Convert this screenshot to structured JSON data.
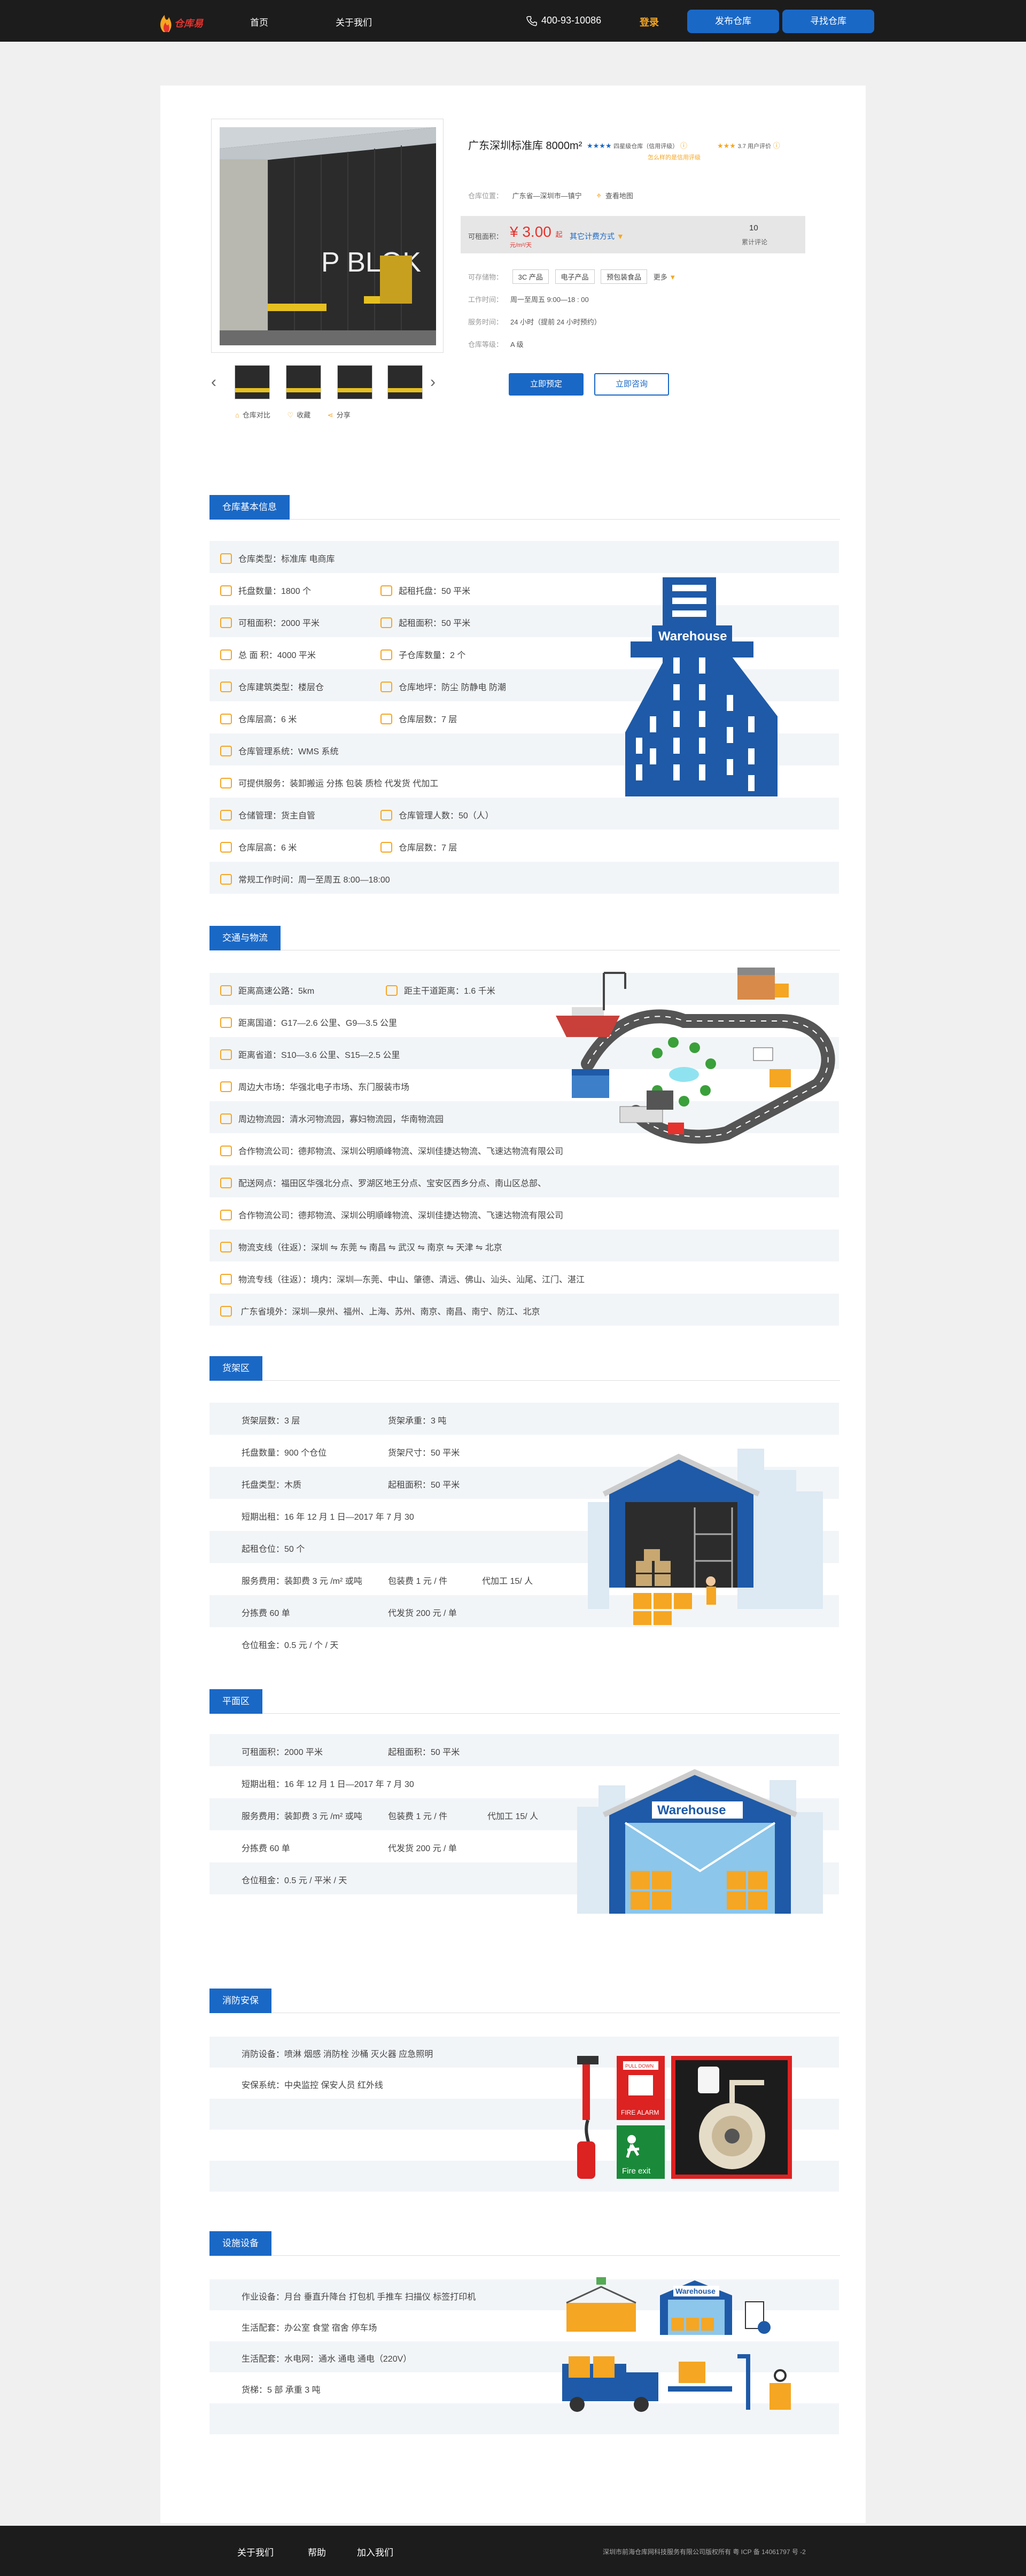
{
  "header": {
    "logo_text": "仓库易",
    "nav": [
      "首页",
      "关于我们"
    ],
    "phone": "400-93-10086",
    "login": "登录",
    "btn_publish": "发布仓库",
    "btn_find": "寻找仓库"
  },
  "product": {
    "image_sign": "P BLOK",
    "title": "广东深圳标准库 8000m²",
    "rating_blue": "★★★★",
    "rating_blue_text": "四星级仓库",
    "rating_blue_extra": "（信用评级）",
    "rating_orange": "★★★",
    "rating_orange_text": "3.7 用户评价",
    "rating_small": "怎么样的是信用评级",
    "location_label": "仓库位置：",
    "location": "广东省—深圳市—镇宁",
    "map_link": "查看地图",
    "price_label": "可租面积：",
    "price": "¥ 3.00",
    "price_unit": "起",
    "price_sub": "元/m²/天",
    "calc": "其它计费方式",
    "reviews_count": "10",
    "reviews_label": "累计评论",
    "goods_label": "可存储物：",
    "goods_tags": [
      "3C 产品",
      "电子产品",
      "预包装食品"
    ],
    "goods_more": "更多",
    "work_label": "工作时间：",
    "work": "周一至周五    9:00—18 : 00",
    "service_label": "服务时间：",
    "service": "24 小时（提前 24 小时预约）",
    "grade_label": "仓库等级：",
    "grade": "A 级",
    "btn_book": "立即预定",
    "btn_consult": "立即咨询",
    "actions": [
      "仓库对比",
      "收藏",
      "分享"
    ]
  },
  "sections": {
    "basic": {
      "title": "仓库基本信息",
      "rows": [
        [
          "仓库类型：标准库   电商库",
          ""
        ],
        [
          "托盘数量：1800 个",
          "起租托盘：50 平米"
        ],
        [
          "可租面积：2000 平米",
          "起租面积：50 平米"
        ],
        [
          "总  面  积：4000 平米",
          "子仓库数量：2 个"
        ],
        [
          "仓库建筑类型：楼层仓",
          "仓库地坪：防尘   防静电   防潮"
        ],
        [
          "仓库层高：6 米",
          "仓库层数：7 层"
        ],
        [
          "仓库管理系统：WMS 系统",
          ""
        ],
        [
          "可提供服务：装卸搬运  分拣  包装  质检  代发货  代加工",
          ""
        ],
        [
          "仓储管理：货主自管",
          "仓库管理人数：50（人）"
        ],
        [
          "仓库层高：6 米",
          "仓库层数：7 层"
        ],
        [
          "常规工作时间：周一至周五    8:00—18:00",
          ""
        ]
      ],
      "illustration_label": "Warehouse"
    },
    "traffic": {
      "title": "交通与物流",
      "rows": [
        [
          "距离高速公路：5km",
          "距主干道距离：1.6 千米"
        ],
        [
          "距离国道：G17—2.6 公里、G9—3.5 公里",
          ""
        ],
        [
          "距离省道：S10—3.6 公里、S15—2.5 公里",
          ""
        ],
        [
          "周边大市场：华强北电子市场、东门服装市场",
          ""
        ],
        [
          "周边物流园：清水河物流园，寡妇物流园，华南物流园",
          ""
        ],
        [
          "合作物流公司：德邦物流、深圳公明順峰物流、深圳佳捷达物流、飞速达物流有限公司",
          ""
        ],
        [
          "配送网点：福田区华强北分点、罗湖区地王分点、宝安区西乡分点、南山区总部、",
          ""
        ],
        [
          "合作物流公司：德邦物流、深圳公明順峰物流、深圳佳捷达物流、飞速达物流有限公司",
          ""
        ],
        [
          "物流支线（往返）：深圳  ⇋  东莞  ⇋  南昌  ⇋  武汉  ⇋  南京  ⇋  天津  ⇋  北京",
          ""
        ],
        [
          "物流专线（往返）：境内：深圳—东莞、中山、肇德、清远、佛山、汕头、汕尾、江门、湛江",
          ""
        ],
        [
          "                               广东省境外：深圳—泉州、福州、上海、苏州、南京、南昌、南宁、防江、北京",
          ""
        ]
      ]
    },
    "rack": {
      "title": "货架区",
      "rows": [
        [
          "货架层数：3 层",
          "货架承重：3 吨",
          ""
        ],
        [
          "托盘数量：900 个仓位",
          "货架尺寸：50 平米",
          ""
        ],
        [
          "托盘类型：木质",
          "起租面积：50 平米",
          ""
        ],
        [
          "短期出租：16 年 12 月 1 日—2017 年 7 月 30",
          "",
          ""
        ],
        [
          "起租仓位：50 个",
          "",
          ""
        ],
        [
          "服务费用：装卸费 3 元 /m² 或吨",
          "包装费  1 元 / 件",
          "代加工 15/ 人"
        ],
        [
          "                分拣费  60 单",
          "代发货 200 元 / 单",
          ""
        ],
        [
          "仓位租金：0.5 元 / 个 / 天",
          "",
          ""
        ]
      ]
    },
    "flat": {
      "title": "平面区",
      "rows": [
        [
          "可租面积：2000 平米",
          "起租面积：50 平米",
          ""
        ],
        [
          "短期出租：16 年 12 月 1 日—2017 年 7 月 30",
          "",
          ""
        ],
        [
          "服务费用：装卸费 3 元 /m² 或吨",
          "包装费  1 元 / 件",
          "代加工 15/ 人"
        ],
        [
          "                分拣费  60 单",
          "代发货 200 元 / 单",
          ""
        ],
        [
          "仓位租金：0.5 元 / 平米 / 天",
          "",
          ""
        ],
        [
          "",
          "",
          ""
        ]
      ],
      "illustration_label": "Warehouse"
    },
    "fire": {
      "title": "消防安保",
      "rows": [
        [
          "消防设备：喷淋  烟感  消防栓  沙桶  灭火器  应急照明"
        ],
        [
          "安保系统：中央监控  保安人员  红外线"
        ],
        [
          ""
        ],
        [
          ""
        ],
        [
          ""
        ]
      ],
      "signs": [
        "PULL DOWN",
        "FIRE  ALARM",
        "Fire exit"
      ]
    },
    "facility": {
      "title": "设施设备",
      "rows": [
        [
          "作业设备：月台  垂直升降台  打包机  手推车  扫描仪  标签打印机"
        ],
        [
          "生活配套：办公室  食堂  宿舍  停车场"
        ],
        [
          "生活配套：水电网：通水  通电  通电（220V）"
        ],
        [
          "货梯：5 部  承重 3 吨"
        ],
        [
          ""
        ]
      ],
      "illustration_label": "Warehouse"
    }
  },
  "footer": {
    "links": [
      "关于我们",
      "帮助",
      "加入我们"
    ],
    "copyright": "深圳市前海仓库网科技服务有限公司版权所有   粤 ICP 备 14061797 号 -2"
  },
  "colors": {
    "primary": "#1a68c6",
    "accent": "#f5a623",
    "price": "#e5322d",
    "header": "#1c1c1c"
  }
}
